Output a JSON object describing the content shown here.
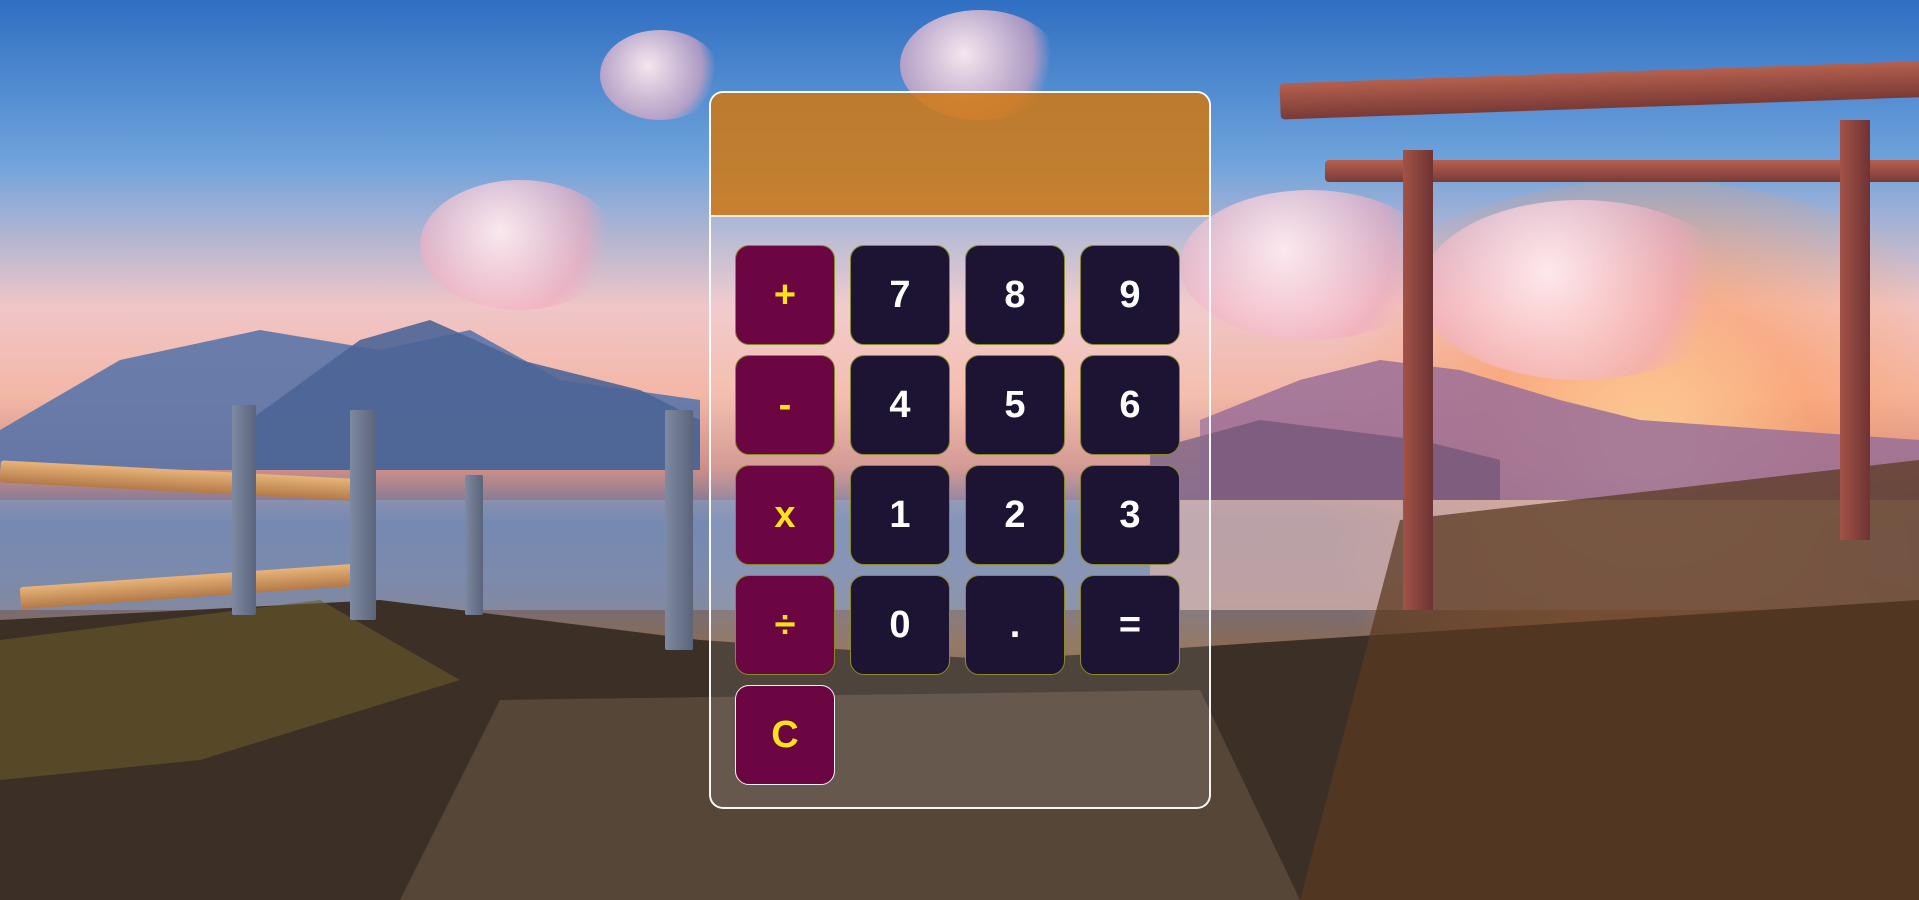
{
  "calculator": {
    "display_value": "",
    "keys": {
      "add": "+",
      "subtract": "-",
      "multiply": "x",
      "divide": "÷",
      "clear": "C",
      "seven": "7",
      "eight": "8",
      "nine": "9",
      "four": "4",
      "five": "5",
      "six": "6",
      "one": "1",
      "two": "2",
      "three": "3",
      "zero": "0",
      "decimal": ".",
      "equals": "="
    },
    "colors": {
      "display": "#d0740a",
      "operator_key": "#6b0642",
      "operator_text": "#ffe31a",
      "number_key": "#1d1433",
      "number_text": "#ffffff"
    }
  }
}
